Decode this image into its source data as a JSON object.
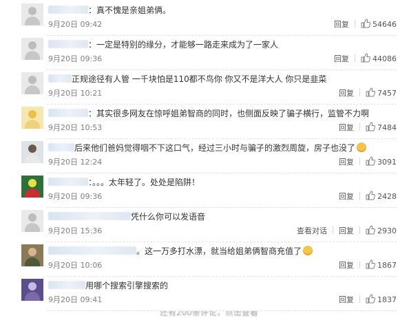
{
  "actions": {
    "reply_label": "回复",
    "view_convo_label": "查看对话"
  },
  "footer": {
    "text": "还有200条评论，点击查看"
  },
  "comments": [
    {
      "text": "：真不愧是亲姐弟俩。",
      "time": "9月20日 09:42",
      "likes": "54646",
      "emoji": ""
    },
    {
      "text": "：一定是特别的缘分，才能够一路走来成为了一家人",
      "time": "9月20日 09:36",
      "likes": "44086",
      "emoji": ""
    },
    {
      "text": "正规途径有人管 一千块怕是110都不鸟你 你又不是洋大人 你只是韭菜",
      "time": "9月20日 10:21",
      "likes": "7457",
      "emoji": ""
    },
    {
      "text": "：其实很多网友在惊呼姐弟智商的同时，也侧面反映了骗子横行，监管不力啊",
      "time": "9月20日 10:53",
      "likes": "7484",
      "emoji": ""
    },
    {
      "text": "后来他们爸妈觉得咽不下这口气，经过三小时与骗子的激烈周旋，房子也没了",
      "time": "9月20日 12:24",
      "likes": "3091",
      "emoji": "face-emoji"
    },
    {
      "text": "：。。。太年轻了。处处是陷阱！",
      "time": "9月20日 09:36",
      "likes": "2428",
      "emoji": ""
    },
    {
      "text": "凭什么你可以发语音",
      "time": "9月20日 15:36",
      "likes": "2930",
      "emoji": ""
    },
    {
      "text": "。这一万多打水漂，就当给姐弟俩智商充值了",
      "time": "9月20日 10:06",
      "likes": "1867",
      "emoji": "face-emoji"
    },
    {
      "text": "用哪个搜索引擎搜索的",
      "time": "9月20日 09:41",
      "likes": "1837",
      "emoji": ""
    }
  ]
}
